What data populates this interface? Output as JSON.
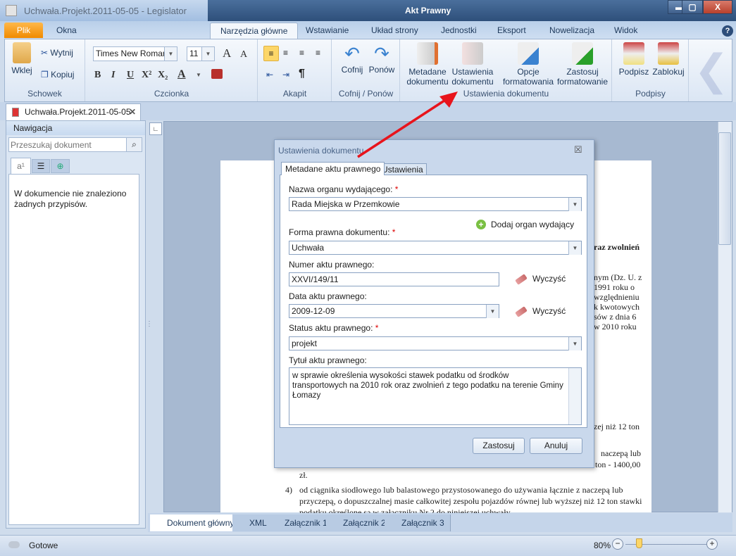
{
  "window": {
    "app_title": "Uchwała.Projekt.2011-05-05 - Legislator",
    "context_title": "Akt Prawny",
    "minimize": "▬",
    "maximize": "▢",
    "close": "X"
  },
  "menu": {
    "file": "Plik",
    "windows": "Okna",
    "tabs": [
      "Narzędzia główne",
      "Wstawianie",
      "Układ strony",
      "Jednostki",
      "Eksport",
      "Nowelizacja",
      "Widok"
    ],
    "help": "?"
  },
  "ribbon": {
    "clipboard": {
      "label": "Schowek",
      "paste": "Wklej",
      "cut": "Wytnij",
      "copy": "Kopiuj"
    },
    "font": {
      "label": "Czcionka",
      "family": "Times New Roman",
      "size": "11",
      "bold": "B",
      "italic": "I",
      "underline": "U",
      "superscript": "X²",
      "subscript": "X₂",
      "color": "A"
    },
    "paragraph": {
      "label": "Akapit",
      "pilcrow": "¶"
    },
    "undo": {
      "label": "Cofnij / Ponów",
      "undo": "Cofnij",
      "redo": "Ponów"
    },
    "docsettings": {
      "label": "Ustawienia dokumentu",
      "metadata": [
        "Metadane",
        "dokumentu"
      ],
      "settings": [
        "Ustawienia",
        "dokumentu"
      ],
      "format_options": [
        "Opcje",
        "formatowania"
      ],
      "apply_format": [
        "Zastosuj",
        "formatowanie"
      ]
    },
    "signatures": {
      "label": "Podpisy",
      "sign": "Podpisz",
      "lock": "Zablokuj"
    }
  },
  "doc_tab": "Uchwała.Projekt.2011-05-05",
  "nav": {
    "title": "Nawigacja",
    "search_placeholder": "Przeszukaj dokument",
    "message": "W dokumencie nie znaleziono żadnych przypisów."
  },
  "page_fragments": [
    "raz zwolnień",
    "nym (Dz. U. z",
    "1991 roku o",
    "względnieniu",
    "k kwotowych",
    "sów z dnia 6",
    "w 2010 roku",
    "zej niż 12 ton",
    "naczepą lub",
    "ton - 1400,00",
    "zł.",
    "4)",
    "od ciągnika siodłowego lub balastowego przystosowanego do używania  łącznie z naczepą lub",
    "przyczepą, o dopuszczalnej masie całkowitej zespołu pojazdów równej lub wyższej niż 12 ton stawki",
    "podatku określone są w załączniku Nr 2 do niniejszej uchwały"
  ],
  "dialog": {
    "title": "Ustawienia dokumentu",
    "close": "☒",
    "tabs": [
      "Metadane aktu prawnego",
      "Ustawienia"
    ],
    "organ_label": "Nazwa organu wydającego:",
    "organ_value": "Rada Miejska w Przemkowie",
    "add_organ": "Dodaj organ wydający",
    "form_label": "Forma prawna dokumentu:",
    "form_value": "Uchwała",
    "number_label": "Numer aktu prawnego:",
    "number_value": "XXVI/149/11",
    "clear": "Wyczyść",
    "date_label": "Data aktu prawnego:",
    "date_value": "2009-12-09",
    "status_label": "Status aktu prawnego:",
    "status_value": "projekt",
    "title_label": "Tytuł aktu prawnego:",
    "title_value": "w sprawie określenia wysokości stawek podatku od środków transportowych na 2010 rok oraz zwolnień z tego podatku na terenie Gminy Łomazy",
    "required": "*",
    "apply": "Zastosuj",
    "cancel": "Anuluj"
  },
  "bottom_tabs": [
    "Dokument główny",
    "XML",
    "Załącznik 1",
    "Załącznik 2",
    "Załącznik 3"
  ],
  "status": {
    "text": "Gotowe",
    "zoom": "80%",
    "zoom_percent": 80
  },
  "colors": {
    "accent": "#f08a00",
    "arrow": "#e8141c",
    "required": "#dd0000"
  }
}
